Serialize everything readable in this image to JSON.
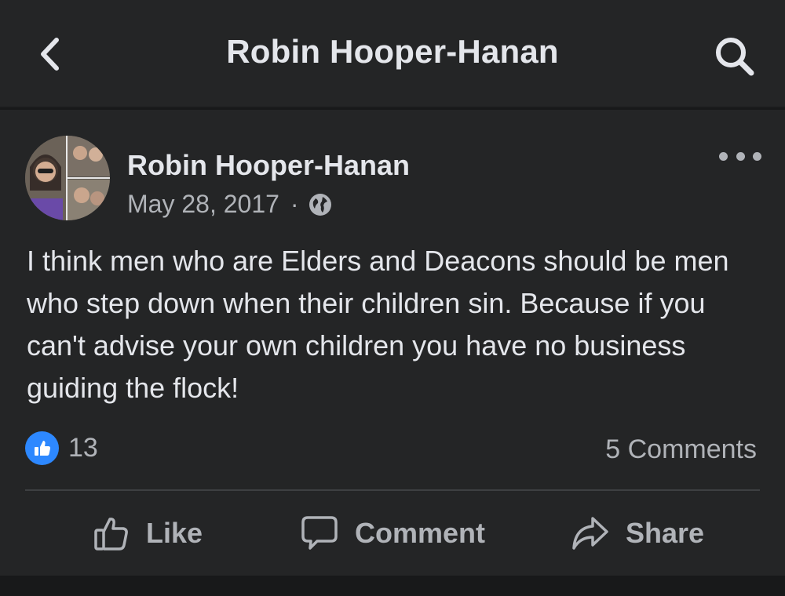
{
  "header": {
    "title": "Robin Hooper-Hanan",
    "back_icon": "chevron-left-icon",
    "search_icon": "search-icon"
  },
  "post": {
    "author": "Robin Hooper-Hanan",
    "date": "May 28, 2017",
    "separator": "·",
    "privacy_icon": "globe-icon",
    "more_icon": "more-horizontal-icon",
    "text": "I think men who are Elders and Deacons should be men who step down when their children sin. Because if you can't advise your own children you have no business guiding the flock!",
    "reaction_count": "13",
    "comments_label": "5 Comments"
  },
  "actions": {
    "like_label": "Like",
    "comment_label": "Comment",
    "share_label": "Share"
  },
  "colors": {
    "background": "#18191a",
    "surface": "#242526",
    "primary_text": "#e4e6eb",
    "secondary_text": "#b0b3b8",
    "like_blue": "#2d88ff",
    "divider": "#3e4042"
  }
}
